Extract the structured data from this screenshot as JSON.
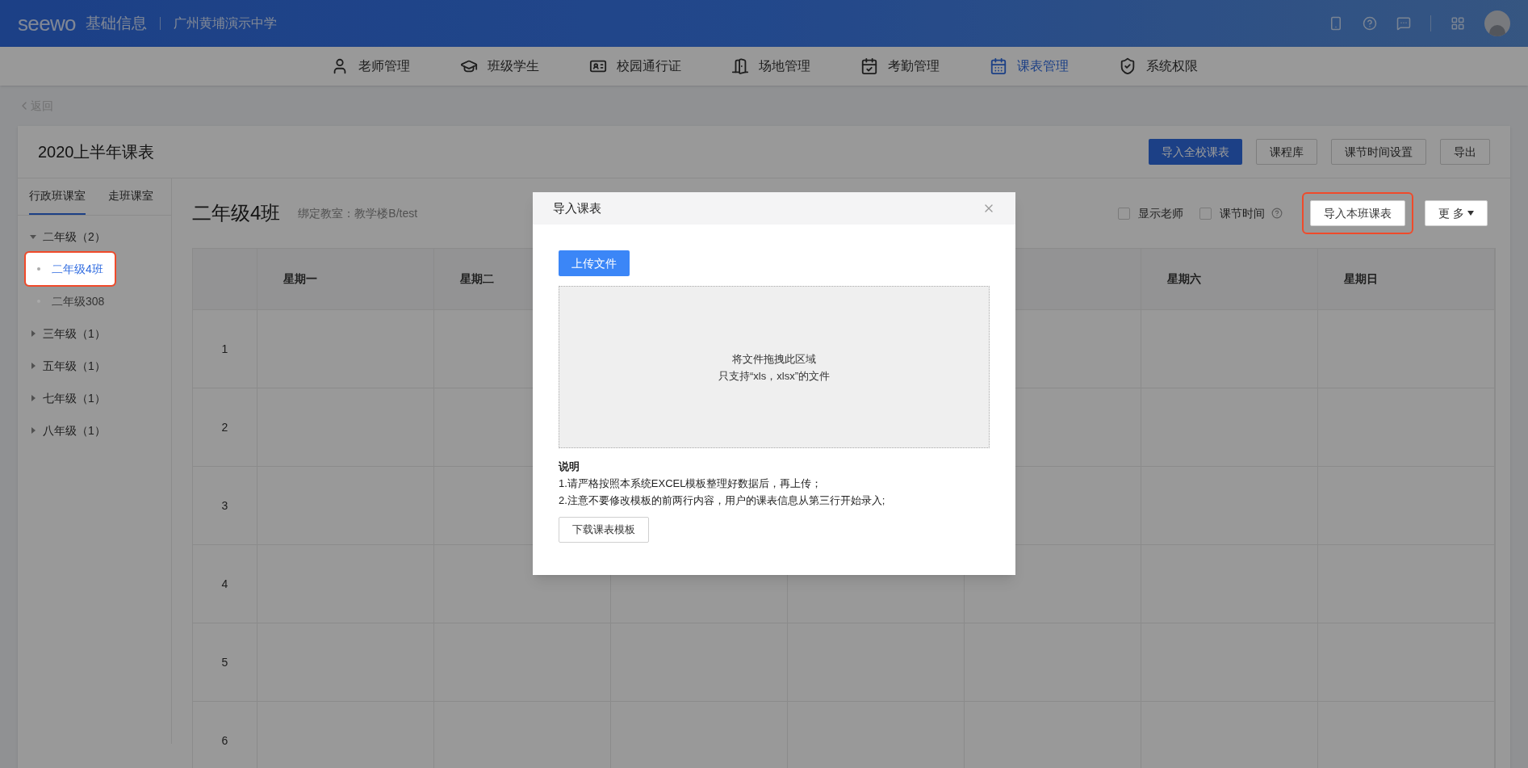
{
  "header": {
    "logo": "seewo",
    "app_name": "基础信息",
    "school": "广州黄埔演示中学"
  },
  "nav": [
    {
      "label": "老师管理",
      "selected": false
    },
    {
      "label": "班级学生",
      "selected": false
    },
    {
      "label": "校园通行证",
      "selected": false
    },
    {
      "label": "场地管理",
      "selected": false
    },
    {
      "label": "考勤管理",
      "selected": false
    },
    {
      "label": "课表管理",
      "selected": true
    },
    {
      "label": "系统权限",
      "selected": false
    }
  ],
  "back_link": "返回",
  "page_title": "2020上半年课表",
  "top_actions": [
    {
      "label": "导入全校课表",
      "kind": "primary"
    },
    {
      "label": "课程库",
      "kind": "default"
    },
    {
      "label": "课节时间设置",
      "kind": "default"
    },
    {
      "label": "导出",
      "kind": "default"
    }
  ],
  "sidebar": {
    "tabs": [
      {
        "label": "行政班课室",
        "selected": true
      },
      {
        "label": "走班课室",
        "selected": false
      }
    ],
    "tree": [
      {
        "label": "二年级（2）",
        "expanded": true,
        "children": [
          {
            "label": "二年级4班",
            "selected": true,
            "highlighted": true
          },
          {
            "label": "二年级308",
            "selected": false,
            "highlighted": false
          }
        ]
      },
      {
        "label": "三年级（1）",
        "expanded": false
      },
      {
        "label": "五年级（1）",
        "expanded": false
      },
      {
        "label": "七年级（1）",
        "expanded": false
      },
      {
        "label": "八年级（1）",
        "expanded": false
      }
    ]
  },
  "class_title": "二年级4班",
  "classroom": "绑定教室：教学楼B/test",
  "options": [
    {
      "label": "显示老师",
      "checked": false,
      "help": false
    },
    {
      "label": "课节时间",
      "checked": false,
      "help": true
    }
  ],
  "class_actions": [
    {
      "label": "导入本班课表",
      "highlighted": true,
      "dropdown": false
    },
    {
      "label": "更 多",
      "highlighted": false,
      "dropdown": true
    }
  ],
  "table": {
    "columns": [
      {
        "label": "星期一"
      },
      {
        "label": "星期二"
      },
      {},
      {},
      {},
      {
        "label": "星期六"
      },
      {
        "label": "星期日"
      }
    ],
    "rows": [
      "1",
      "2",
      "3",
      "4",
      "5",
      "6"
    ]
  },
  "dialog": {
    "title": "导入课表",
    "upload_button": "上传文件",
    "drop_lines": [
      "将文件拖拽此区域",
      "只支持“xls，xlsx”的文件"
    ],
    "notes_title": "说明",
    "notes": [
      "1.请严格按照本系统EXCEL模板整理好数据后，再上传；",
      "2.注意不要修改模板的前两行内容，用户的课表信息从第三行开始录入;"
    ],
    "download_button": "下载课表模板"
  }
}
